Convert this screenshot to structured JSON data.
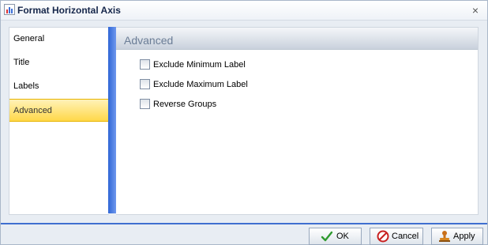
{
  "window": {
    "title": "Format Horizontal Axis",
    "close_label": "×"
  },
  "nav": {
    "items": [
      {
        "label": "General"
      },
      {
        "label": "Title"
      },
      {
        "label": "Labels"
      },
      {
        "label": "Advanced",
        "selected": true
      }
    ]
  },
  "content": {
    "title": "Advanced",
    "options": [
      {
        "label": "Exclude Minimum Label",
        "checked": false
      },
      {
        "label": "Exclude Maximum Label",
        "checked": false
      },
      {
        "label": "Reverse Groups",
        "checked": false
      }
    ]
  },
  "buttons": {
    "ok": "OK",
    "cancel": "Cancel",
    "apply": "Apply"
  },
  "colors": {
    "accent": "#3f6fd0",
    "selection": "#ffd84a"
  },
  "icons": {
    "window": "chart-icon",
    "ok": "checkmark-icon",
    "cancel": "cancel-icon",
    "apply": "stamp-icon"
  }
}
